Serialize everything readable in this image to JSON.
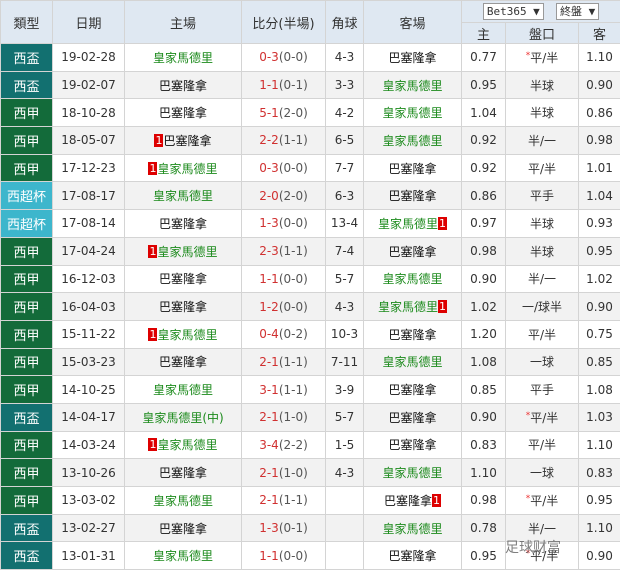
{
  "header": {
    "type": "類型",
    "date": "日期",
    "home": "主場",
    "score": "比分(半場)",
    "corner": "角球",
    "away": "客場",
    "bookmaker": "Bet365 ▼",
    "odds_type": "終盤 ▼",
    "odds_home": "主",
    "handicap": "盤口",
    "odds_away": "客"
  },
  "colors": {
    "西盃": "#127070",
    "西甲": "#136b3a",
    "西超杯": "#3db6cc",
    "home_team_green": "#1b8a1b",
    "score_red": "#d03030"
  },
  "rows": [
    {
      "type": "西盃",
      "date": "19-02-28",
      "home": "皇家馬德里",
      "home_card": "",
      "full": "0-3",
      "half": "(0-0)",
      "corner": "4-3",
      "away": "巴塞隆拿",
      "away_card": "",
      "o_home": "0.77",
      "star": "*",
      "handicap": "平/半",
      "o_away": "1.10",
      "home_green": true
    },
    {
      "type": "西盃",
      "date": "19-02-07",
      "home": "巴塞隆拿",
      "home_card": "",
      "full": "1-1",
      "half": "(0-1)",
      "corner": "3-3",
      "away": "皇家馬德里",
      "away_card": "",
      "o_home": "0.95",
      "star": "",
      "handicap": "半球",
      "o_away": "0.90",
      "home_green": false
    },
    {
      "type": "西甲",
      "date": "18-10-28",
      "home": "巴塞隆拿",
      "home_card": "",
      "full": "5-1",
      "half": "(2-0)",
      "corner": "4-2",
      "away": "皇家馬德里",
      "away_card": "",
      "o_home": "1.04",
      "star": "",
      "handicap": "半球",
      "o_away": "0.86",
      "home_green": false
    },
    {
      "type": "西甲",
      "date": "18-05-07",
      "home": "巴塞隆拿",
      "home_card": "1",
      "full": "2-2",
      "half": "(1-1)",
      "corner": "6-5",
      "away": "皇家馬德里",
      "away_card": "",
      "o_home": "0.92",
      "star": "",
      "handicap": "半/一",
      "o_away": "0.98",
      "home_green": false
    },
    {
      "type": "西甲",
      "date": "17-12-23",
      "home": "皇家馬德里",
      "home_card": "1",
      "full": "0-3",
      "half": "(0-0)",
      "corner": "7-7",
      "away": "巴塞隆拿",
      "away_card": "",
      "o_home": "0.92",
      "star": "",
      "handicap": "平/半",
      "o_away": "1.01",
      "home_green": true
    },
    {
      "type": "西超杯",
      "date": "17-08-17",
      "home": "皇家馬德里",
      "home_card": "",
      "full": "2-0",
      "half": "(2-0)",
      "corner": "6-3",
      "away": "巴塞隆拿",
      "away_card": "",
      "o_home": "0.86",
      "star": "",
      "handicap": "平手",
      "o_away": "1.04",
      "home_green": true
    },
    {
      "type": "西超杯",
      "date": "17-08-14",
      "home": "巴塞隆拿",
      "home_card": "",
      "full": "1-3",
      "half": "(0-0)",
      "corner": "13-4",
      "away": "皇家馬德里",
      "away_card": "1",
      "o_home": "0.97",
      "star": "",
      "handicap": "半球",
      "o_away": "0.93",
      "home_green": false
    },
    {
      "type": "西甲",
      "date": "17-04-24",
      "home": "皇家馬德里",
      "home_card": "1",
      "full": "2-3",
      "half": "(1-1)",
      "corner": "7-4",
      "away": "巴塞隆拿",
      "away_card": "",
      "o_home": "0.98",
      "star": "",
      "handicap": "半球",
      "o_away": "0.95",
      "home_green": true
    },
    {
      "type": "西甲",
      "date": "16-12-03",
      "home": "巴塞隆拿",
      "home_card": "",
      "full": "1-1",
      "half": "(0-0)",
      "corner": "5-7",
      "away": "皇家馬德里",
      "away_card": "",
      "o_home": "0.90",
      "star": "",
      "handicap": "半/一",
      "o_away": "1.02",
      "home_green": false
    },
    {
      "type": "西甲",
      "date": "16-04-03",
      "home": "巴塞隆拿",
      "home_card": "",
      "full": "1-2",
      "half": "(0-0)",
      "corner": "4-3",
      "away": "皇家馬德里",
      "away_card": "1",
      "o_home": "1.02",
      "star": "",
      "handicap": "一/球半",
      "o_away": "0.90",
      "home_green": false
    },
    {
      "type": "西甲",
      "date": "15-11-22",
      "home": "皇家馬德里",
      "home_card": "1",
      "full": "0-4",
      "half": "(0-2)",
      "corner": "10-3",
      "away": "巴塞隆拿",
      "away_card": "",
      "o_home": "1.20",
      "star": "",
      "handicap": "平/半",
      "o_away": "0.75",
      "home_green": true
    },
    {
      "type": "西甲",
      "date": "15-03-23",
      "home": "巴塞隆拿",
      "home_card": "",
      "full": "2-1",
      "half": "(1-1)",
      "corner": "7-11",
      "away": "皇家馬德里",
      "away_card": "",
      "o_home": "1.08",
      "star": "",
      "handicap": "一球",
      "o_away": "0.85",
      "home_green": false
    },
    {
      "type": "西甲",
      "date": "14-10-25",
      "home": "皇家馬德里",
      "home_card": "",
      "full": "3-1",
      "half": "(1-1)",
      "corner": "3-9",
      "away": "巴塞隆拿",
      "away_card": "",
      "o_home": "0.85",
      "star": "",
      "handicap": "平手",
      "o_away": "1.08",
      "home_green": true
    },
    {
      "type": "西盃",
      "date": "14-04-17",
      "home": "皇家馬德里(中)",
      "home_card": "",
      "full": "2-1",
      "half": "(1-0)",
      "corner": "5-7",
      "away": "巴塞隆拿",
      "away_card": "",
      "o_home": "0.90",
      "star": "*",
      "handicap": "平/半",
      "o_away": "1.03",
      "home_green": true
    },
    {
      "type": "西甲",
      "date": "14-03-24",
      "home": "皇家馬德里",
      "home_card": "1",
      "full": "3-4",
      "half": "(2-2)",
      "corner": "1-5",
      "away": "巴塞隆拿",
      "away_card": "",
      "o_home": "0.83",
      "star": "",
      "handicap": "平/半",
      "o_away": "1.10",
      "home_green": true
    },
    {
      "type": "西甲",
      "date": "13-10-26",
      "home": "巴塞隆拿",
      "home_card": "",
      "full": "2-1",
      "half": "(1-0)",
      "corner": "4-3",
      "away": "皇家馬德里",
      "away_card": "",
      "o_home": "1.10",
      "star": "",
      "handicap": "一球",
      "o_away": "0.83",
      "home_green": false
    },
    {
      "type": "西甲",
      "date": "13-03-02",
      "home": "皇家馬德里",
      "home_card": "",
      "full": "2-1",
      "half": "(1-1)",
      "corner": "",
      "away": "巴塞隆拿",
      "away_card": "1",
      "o_home": "0.98",
      "star": "*",
      "handicap": "平/半",
      "o_away": "0.95",
      "home_green": true
    },
    {
      "type": "西盃",
      "date": "13-02-27",
      "home": "巴塞隆拿",
      "home_card": "",
      "full": "1-3",
      "half": "(0-1)",
      "corner": "",
      "away": "皇家馬德里",
      "away_card": "",
      "o_home": "0.78",
      "star": "",
      "handicap": "半/一",
      "o_away": "1.10",
      "home_green": false
    },
    {
      "type": "西盃",
      "date": "13-01-31",
      "home": "皇家馬德里",
      "home_card": "",
      "full": "1-1",
      "half": "(0-0)",
      "corner": "",
      "away": "巴塞隆拿",
      "away_card": "",
      "o_home": "0.95",
      "star": "*",
      "handicap": "平/半",
      "o_away": "0.90",
      "home_green": true
    }
  ],
  "watermark": "足球财富"
}
